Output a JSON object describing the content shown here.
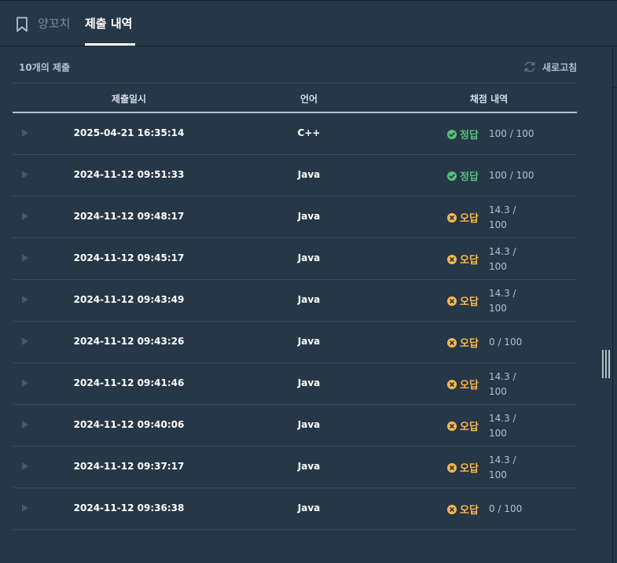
{
  "tabs": {
    "bookmark_label": "양꼬치",
    "submissions_label": "제출 내역"
  },
  "panel": {
    "count_label": "10개의 제출",
    "refresh_label": "새로고침"
  },
  "table": {
    "headers": {
      "date": "제출일시",
      "language": "언어",
      "result": "채점 내역"
    },
    "rows": [
      {
        "date": "2025-04-21 16:35:14",
        "language": "C++",
        "status": "pass",
        "status_label": "정답",
        "score_a": "100 / 100",
        "score_b": ""
      },
      {
        "date": "2024-11-12 09:51:33",
        "language": "Java",
        "status": "pass",
        "status_label": "정답",
        "score_a": "100 / 100",
        "score_b": ""
      },
      {
        "date": "2024-11-12 09:48:17",
        "language": "Java",
        "status": "fail",
        "status_label": "오답",
        "score_a": "14.3 /",
        "score_b": "100"
      },
      {
        "date": "2024-11-12 09:45:17",
        "language": "Java",
        "status": "fail",
        "status_label": "오답",
        "score_a": "14.3 /",
        "score_b": "100"
      },
      {
        "date": "2024-11-12 09:43:49",
        "language": "Java",
        "status": "fail",
        "status_label": "오답",
        "score_a": "14.3 /",
        "score_b": "100"
      },
      {
        "date": "2024-11-12 09:43:26",
        "language": "Java",
        "status": "fail",
        "status_label": "오답",
        "score_a": "0 / 100",
        "score_b": ""
      },
      {
        "date": "2024-11-12 09:41:46",
        "language": "Java",
        "status": "fail",
        "status_label": "오답",
        "score_a": "14.3 /",
        "score_b": "100"
      },
      {
        "date": "2024-11-12 09:40:06",
        "language": "Java",
        "status": "fail",
        "status_label": "오답",
        "score_a": "14.3 /",
        "score_b": "100"
      },
      {
        "date": "2024-11-12 09:37:17",
        "language": "Java",
        "status": "fail",
        "status_label": "오답",
        "score_a": "14.3 /",
        "score_b": "100"
      },
      {
        "date": "2024-11-12 09:36:38",
        "language": "Java",
        "status": "fail",
        "status_label": "오답",
        "score_a": "0 / 100",
        "score_b": ""
      }
    ]
  },
  "colors": {
    "background": "#263747",
    "pass": "#54c27a",
    "fail": "#ffb84d",
    "muted_text": "#b2c0cc"
  },
  "icons": {
    "bookmark": "bookmark-icon",
    "refresh": "refresh-icon",
    "expand": "play-triangle-icon",
    "pass": "check-circle-icon",
    "fail": "x-circle-icon"
  }
}
